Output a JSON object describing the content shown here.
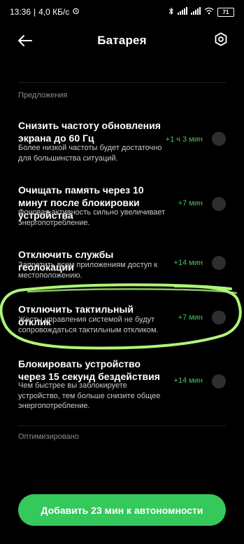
{
  "status_bar": {
    "time": "13:36",
    "network_speed": "4,0 КБ/с",
    "battery_level": "71",
    "icons": [
      "alarm-icon",
      "bluetooth-icon",
      "signal-icon",
      "signal-icon",
      "wifi-icon",
      "battery-icon"
    ]
  },
  "header": {
    "title": "Батарея",
    "back_icon": "arrow-left-icon",
    "settings_icon": "hexagon-settings-icon"
  },
  "sections": {
    "suggestions_label": "Предложения",
    "optimized_label": "Оптимизировано"
  },
  "suggestions": [
    {
      "title": "Снизить частоту обновления экрана до 60 Гц",
      "description": "Более низкой частоты будет достаточно для большинства ситуаций.",
      "gain": "+1 ч 3 мин",
      "enabled": false
    },
    {
      "title": "Очищать память через 10 минут после блокировки устройства",
      "description": "Фоновая активность сильно увеличивает энергопотребление.",
      "gain": "+7 мин",
      "enabled": false
    },
    {
      "title": "Отключить службы геолокации",
      "description": "Запретить всем приложениям доступ к местоположению.",
      "gain": "+14 мин",
      "enabled": false
    },
    {
      "title": "Отключить тактильный отклик",
      "description": "Жесты управления системой не будут сопровождаться тактильным откликом.",
      "gain": "+7 мин",
      "enabled": false
    },
    {
      "title": "Блокировать устройство через 15 секунд бездействия",
      "description": "Чем быстрее вы заблокируете устройство, тем больше снизите общее энергопотребление.",
      "gain": "+14 мин",
      "enabled": false
    }
  ],
  "cta": {
    "label": "Добавить 23 мин к автономности"
  },
  "colors": {
    "background": "#000000",
    "accent_green": "#35c85a",
    "gain_green": "#45c45e",
    "highlight_stroke": "#aef57a",
    "toggle_off": "#2e2e2e"
  }
}
